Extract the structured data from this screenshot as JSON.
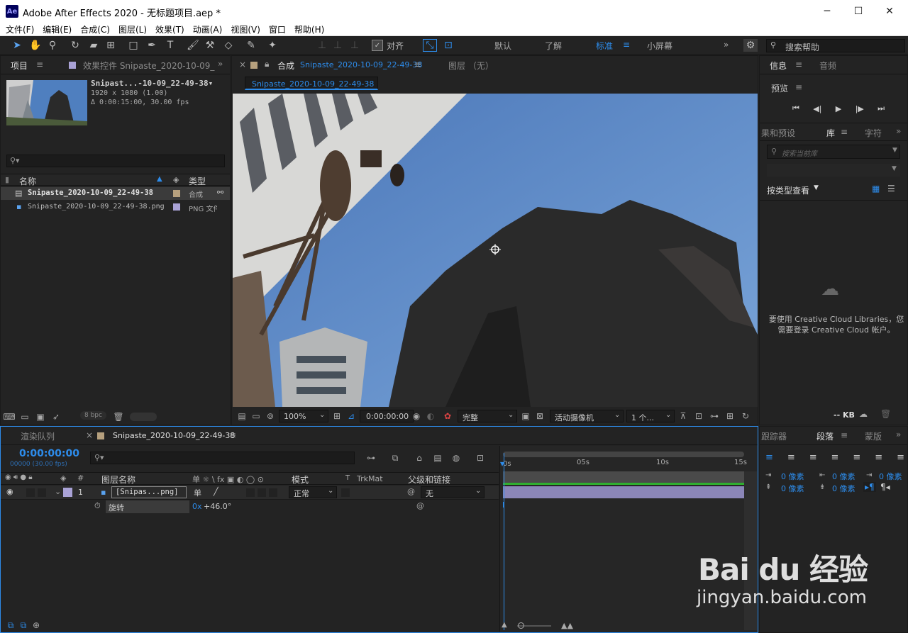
{
  "window": {
    "app_icon": "Ae",
    "title": "Adobe After Effects 2020 - 无标题项目.aep *",
    "minimize": "─",
    "maximize": "☐",
    "close": "✕"
  },
  "menu": [
    "文件(F)",
    "编辑(E)",
    "合成(C)",
    "图层(L)",
    "效果(T)",
    "动画(A)",
    "视图(V)",
    "窗口",
    "帮助(H)"
  ],
  "toolbar": {
    "snap_label": "对齐",
    "workspaces": [
      "默认",
      "了解",
      "标准",
      "小屏幕"
    ],
    "active_workspace": "标准",
    "search_help_placeholder": "搜索帮助"
  },
  "project_panel": {
    "tab_project": "项目",
    "tab_effects": "效果控件 Snipaste_2020-10-09_",
    "item_name": "Snipast...-10-09_22-49-38▾",
    "item_dims": "1920 x 1080 (1.00)",
    "item_duration": "Δ 0:00:15:00, 30.00 fps",
    "col_name": "名称",
    "col_type": "类型",
    "rows": [
      {
        "name": "Snipaste_2020-10-09_22-49-38",
        "type": "合成",
        "color": "#b6a07e"
      },
      {
        "name": "Snipaste_2020-10-09_22-49-38.png",
        "type": "PNG 文件",
        "color": "#a9a2d6"
      }
    ],
    "bpc": "8 bpc"
  },
  "comp_panel": {
    "tab_label": "合成",
    "comp_name": "Snipaste_2020-10-09_22-49-38",
    "layer_tab": "图层 （无）",
    "sub_tab": "Snipaste_2020-10-09_22-49-38",
    "zoom": "100%",
    "timecode": "0:00:00:00",
    "quality": "完整",
    "camera": "活动摄像机",
    "views": "1 个..."
  },
  "right_panel": {
    "tab_info": "信息",
    "tab_audio": "音频",
    "preview_label": "预览",
    "tab_effects_presets": "果和预设",
    "tab_library": "库",
    "tab_char": "字符",
    "library_search_placeholder": "搜索当前库",
    "view_by_type": "按类型查看",
    "cc_message_1": "要使用 Creative Cloud Libraries，您",
    "cc_message_2": "需要登录 Creative Cloud 帐户。",
    "kb": "-- KB",
    "tab_tracker": "跟踪器",
    "tab_paragraph": "段落",
    "tab_mask": "蒙版",
    "para_values": [
      "0 像素",
      "0 像素",
      "0 像素",
      "0 像素",
      "0 像素"
    ]
  },
  "timeline": {
    "tab_render": "渲染队列",
    "tab_comp": "Snipaste_2020-10-09_22-49-38",
    "timecode": "0:00:00:00",
    "frame_info": "00000 (30.00 fps)",
    "col_num": "#",
    "col_layer_name": "图层名称",
    "col_switches": "单 ☼ \\ fx ▣ ◐ ◯ ⊙",
    "col_mode": "模式",
    "col_t": "T",
    "col_trkmat": "TrkMat",
    "col_parent": "父级和链接",
    "ruler": [
      "0s",
      "05s",
      "10s",
      "15s"
    ],
    "layer": {
      "index": "1",
      "name": "[Snipas...png]",
      "mode": "正常",
      "parent": "无",
      "color": "#a9a2d6"
    },
    "property": {
      "name": "旋转",
      "value_turns": "0x",
      "value_deg": "+46.0°"
    }
  },
  "watermark": {
    "brand": "Bai du 经验",
    "url": "jingyan.baidu.com"
  }
}
